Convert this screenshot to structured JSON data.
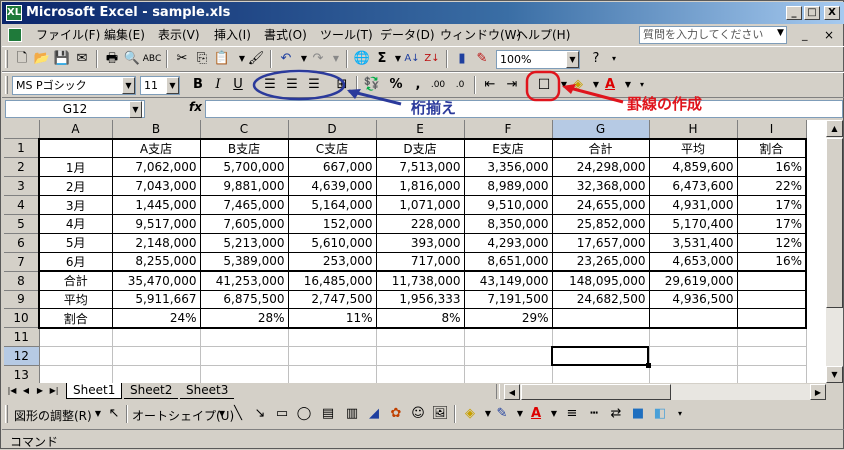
{
  "window": {
    "title": "Microsoft Excel - sample.xls",
    "app_icon": "XL",
    "caption_buttons": [
      "_",
      "□",
      "X"
    ],
    "doc_buttons": [
      "_",
      "×"
    ]
  },
  "menu": {
    "items": [
      "ファイル(F)",
      "編集(E)",
      "表示(V)",
      "挿入(I)",
      "書式(O)",
      "ツール(T)",
      "データ(D)",
      "ウィンドウ(W)",
      "ヘルプ(H)"
    ],
    "ask_placeholder": "質問を入力してください"
  },
  "toolbar_standard": {
    "zoom": "100%"
  },
  "toolbar_format": {
    "font_name": "MS Pゴシック",
    "font_size": "11",
    "bold": "B",
    "italic": "I",
    "underline": "U",
    "percent": "%",
    "comma": ","
  },
  "formula_bar": {
    "name_box": "G12",
    "fx": "fx",
    "value": ""
  },
  "grid": {
    "col_headers": [
      "A",
      "B",
      "C",
      "D",
      "E",
      "F",
      "G",
      "H",
      "I"
    ],
    "selected_col": "G",
    "selected_row": "12",
    "rows": [
      {
        "n": "1",
        "cells": [
          "",
          "A支店",
          "B支店",
          "C支店",
          "D支店",
          "E支店",
          "合計",
          "平均",
          "割合"
        ]
      },
      {
        "n": "2",
        "cells": [
          "1月",
          "7,062,000",
          "5,700,000",
          "667,000",
          "7,513,000",
          "3,356,000",
          "24,298,000",
          "4,859,600",
          "16%"
        ]
      },
      {
        "n": "3",
        "cells": [
          "2月",
          "7,043,000",
          "9,881,000",
          "4,639,000",
          "1,816,000",
          "8,989,000",
          "32,368,000",
          "6,473,600",
          "22%"
        ]
      },
      {
        "n": "4",
        "cells": [
          "3月",
          "1,445,000",
          "7,465,000",
          "5,164,000",
          "1,071,000",
          "9,510,000",
          "24,655,000",
          "4,931,000",
          "17%"
        ]
      },
      {
        "n": "5",
        "cells": [
          "4月",
          "9,517,000",
          "7,605,000",
          "152,000",
          "228,000",
          "8,350,000",
          "25,852,000",
          "5,170,400",
          "17%"
        ]
      },
      {
        "n": "6",
        "cells": [
          "5月",
          "2,148,000",
          "5,213,000",
          "5,610,000",
          "393,000",
          "4,293,000",
          "17,657,000",
          "3,531,400",
          "12%"
        ]
      },
      {
        "n": "7",
        "cells": [
          "6月",
          "8,255,000",
          "5,389,000",
          "253,000",
          "717,000",
          "8,651,000",
          "23,265,000",
          "4,653,000",
          "16%"
        ]
      },
      {
        "n": "8",
        "cells": [
          "合計",
          "35,470,000",
          "41,253,000",
          "16,485,000",
          "11,738,000",
          "43,149,000",
          "148,095,000",
          "29,619,000",
          ""
        ]
      },
      {
        "n": "9",
        "cells": [
          "平均",
          "5,911,667",
          "6,875,500",
          "2,747,500",
          "1,956,333",
          "7,191,500",
          "24,682,500",
          "4,936,500",
          ""
        ]
      },
      {
        "n": "10",
        "cells": [
          "割合",
          "24%",
          "28%",
          "11%",
          "8%",
          "29%",
          "",
          "",
          ""
        ]
      },
      {
        "n": "11",
        "cells": [
          "",
          "",
          "",
          "",
          "",
          "",
          "",
          "",
          ""
        ]
      },
      {
        "n": "12",
        "cells": [
          "",
          "",
          "",
          "",
          "",
          "",
          "",
          "",
          ""
        ]
      },
      {
        "n": "13",
        "cells": [
          "",
          "",
          "",
          "",
          "",
          "",
          "",
          "",
          ""
        ]
      }
    ]
  },
  "sheet_tabs": [
    "Sheet1",
    "Sheet2",
    "Sheet3"
  ],
  "active_sheet": "Sheet1",
  "drawing_toolbar": {
    "draw_menu": "図形の調整(R)",
    "autoshape": "オートシェイプ(U)"
  },
  "status_bar": {
    "text": "コマンド"
  },
  "annotations": {
    "align_label": "桁揃え",
    "border_label": "罫線の作成",
    "align_color": "#2b3a9b",
    "border_color": "#e0141c"
  }
}
